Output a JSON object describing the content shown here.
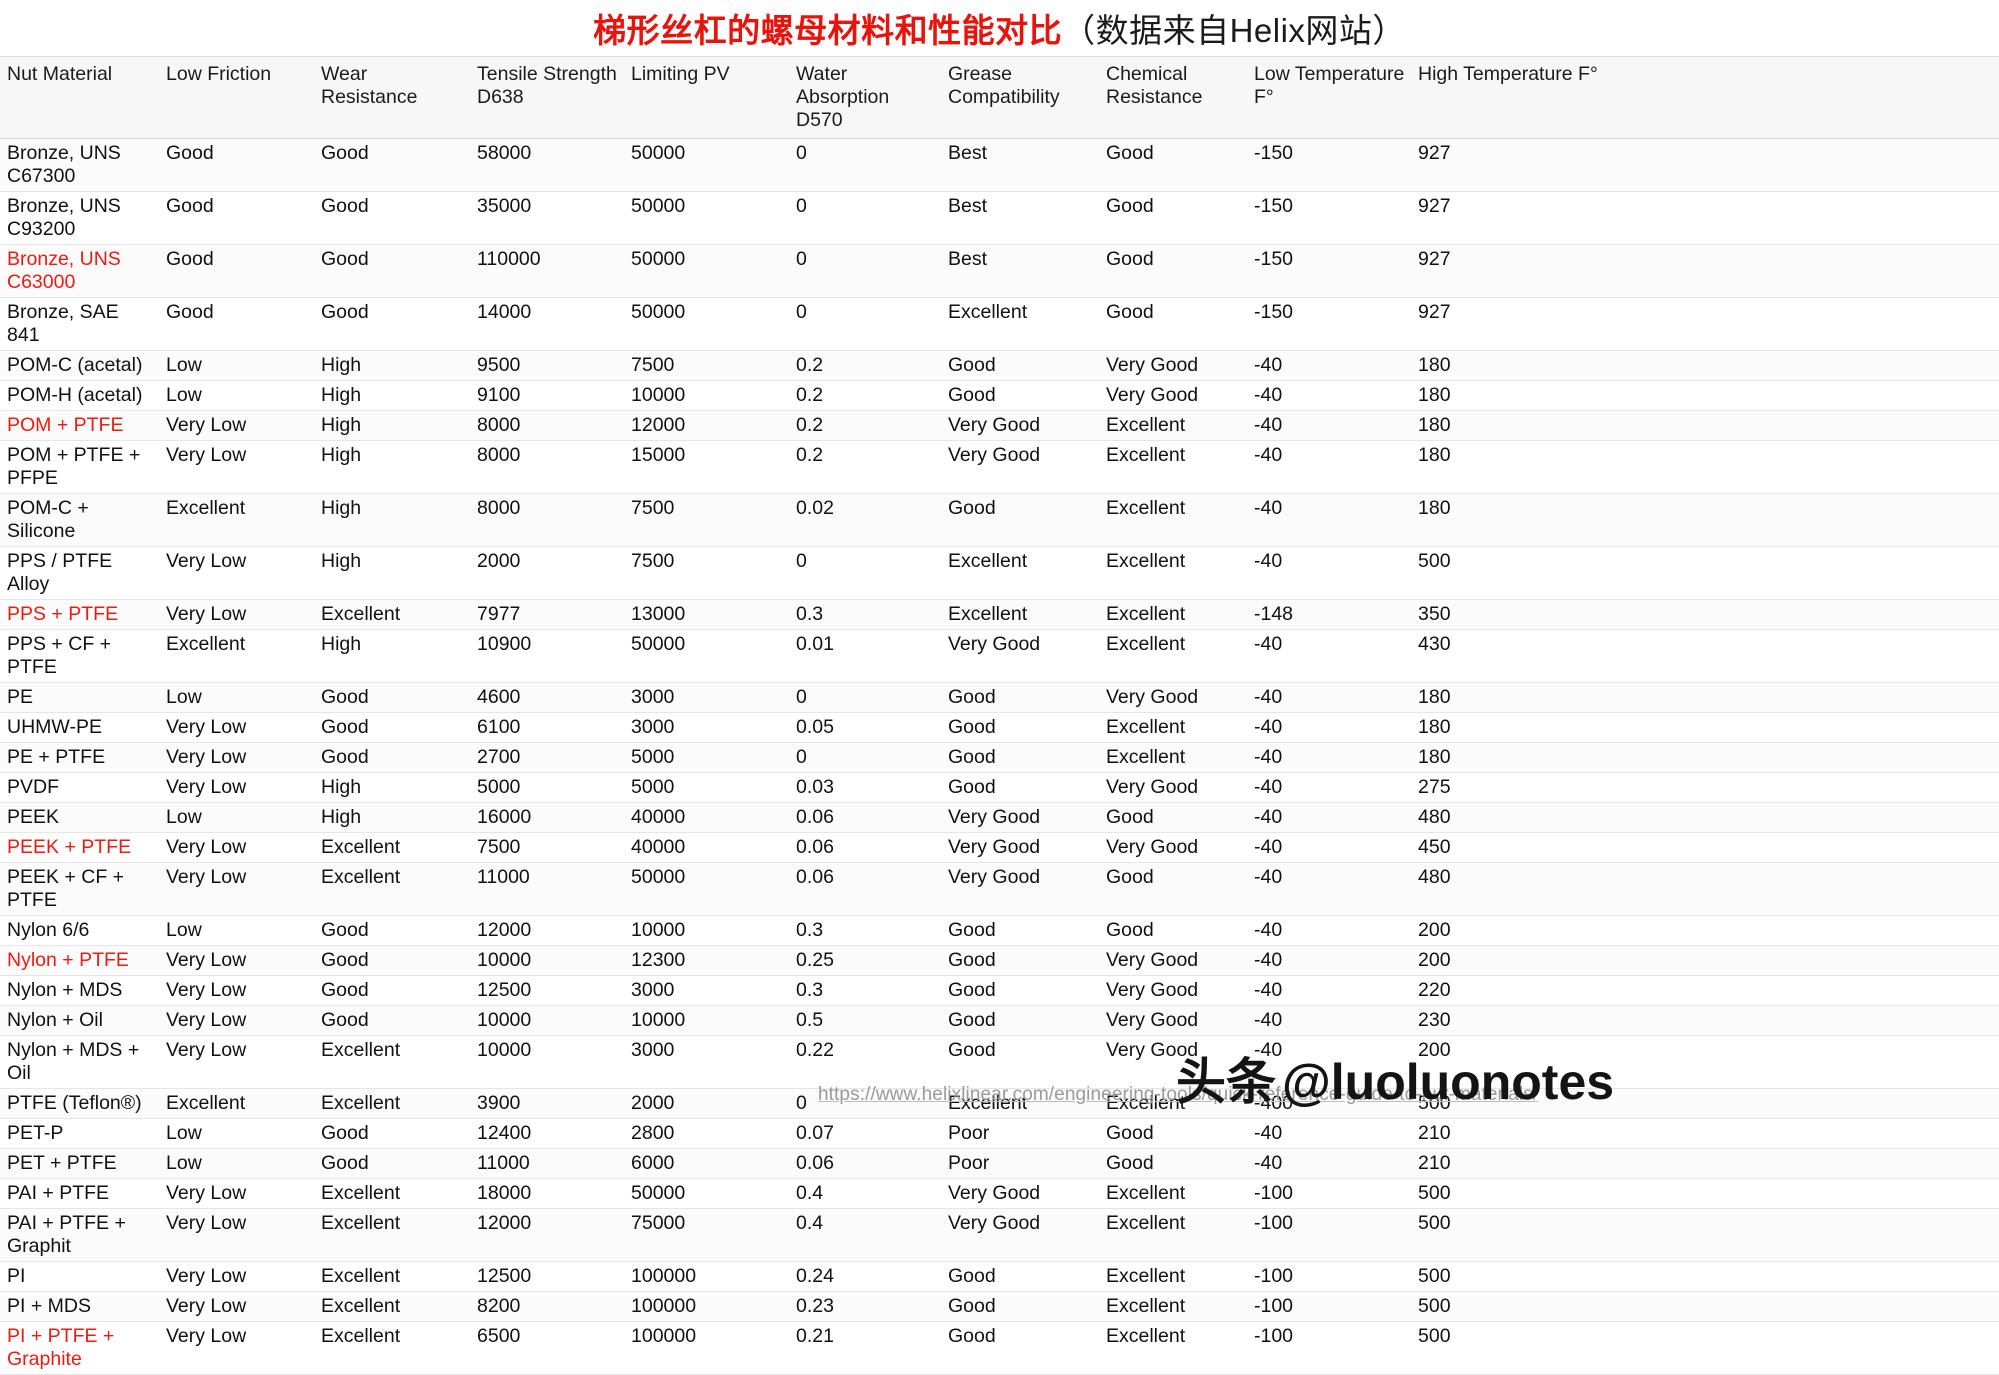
{
  "title": {
    "red_part": "梯形丝杠的螺母材料和性能对比",
    "black_part": "（数据来自Helix网站）"
  },
  "table": {
    "columns": [
      "Nut Material",
      "Low Friction",
      "Wear Resistance",
      "Tensile Strength D638",
      "Limiting PV",
      "Water Absorption D570",
      "Grease Compatibility",
      "Chemical Resistance",
      "Low Temperature F°",
      "High Temperature F°"
    ],
    "rows": [
      {
        "material": "Bronze, UNS C67300",
        "highlight": false,
        "low_friction": "Good",
        "wear_resistance": "Good",
        "tensile_strength": "58000",
        "limiting_pv": "50000",
        "water_absorption": "0",
        "grease_compatibility": "Best",
        "chemical_resistance": "Good",
        "low_temp": "-150",
        "high_temp": "927"
      },
      {
        "material": "Bronze, UNS C93200",
        "highlight": false,
        "low_friction": "Good",
        "wear_resistance": "Good",
        "tensile_strength": "35000",
        "limiting_pv": "50000",
        "water_absorption": "0",
        "grease_compatibility": "Best",
        "chemical_resistance": "Good",
        "low_temp": "-150",
        "high_temp": "927"
      },
      {
        "material": "Bronze, UNS C63000",
        "highlight": true,
        "low_friction": "Good",
        "wear_resistance": "Good",
        "tensile_strength": "110000",
        "limiting_pv": "50000",
        "water_absorption": "0",
        "grease_compatibility": "Best",
        "chemical_resistance": "Good",
        "low_temp": "-150",
        "high_temp": "927"
      },
      {
        "material": "Bronze, SAE 841",
        "highlight": false,
        "low_friction": "Good",
        "wear_resistance": "Good",
        "tensile_strength": "14000",
        "limiting_pv": "50000",
        "water_absorption": "0",
        "grease_compatibility": "Excellent",
        "chemical_resistance": "Good",
        "low_temp": "-150",
        "high_temp": "927"
      },
      {
        "material": "POM-C (acetal)",
        "highlight": false,
        "low_friction": "Low",
        "wear_resistance": "High",
        "tensile_strength": "9500",
        "limiting_pv": "7500",
        "water_absorption": "0.2",
        "grease_compatibility": "Good",
        "chemical_resistance": "Very Good",
        "low_temp": "-40",
        "high_temp": "180"
      },
      {
        "material": "POM-H (acetal)",
        "highlight": false,
        "low_friction": "Low",
        "wear_resistance": "High",
        "tensile_strength": "9100",
        "limiting_pv": "10000",
        "water_absorption": "0.2",
        "grease_compatibility": "Good",
        "chemical_resistance": "Very Good",
        "low_temp": "-40",
        "high_temp": "180"
      },
      {
        "material": "POM + PTFE",
        "highlight": true,
        "low_friction": "Very Low",
        "wear_resistance": "High",
        "tensile_strength": "8000",
        "limiting_pv": "12000",
        "water_absorption": "0.2",
        "grease_compatibility": "Very Good",
        "chemical_resistance": "Excellent",
        "low_temp": "-40",
        "high_temp": "180"
      },
      {
        "material": "POM + PTFE + PFPE",
        "highlight": false,
        "low_friction": "Very Low",
        "wear_resistance": "High",
        "tensile_strength": "8000",
        "limiting_pv": "15000",
        "water_absorption": "0.2",
        "grease_compatibility": "Very Good",
        "chemical_resistance": "Excellent",
        "low_temp": "-40",
        "high_temp": "180"
      },
      {
        "material": "POM-C + Silicone",
        "highlight": false,
        "low_friction": "Excellent",
        "wear_resistance": "High",
        "tensile_strength": "8000",
        "limiting_pv": "7500",
        "water_absorption": "0.02",
        "grease_compatibility": "Good",
        "chemical_resistance": "Excellent",
        "low_temp": "-40",
        "high_temp": "180"
      },
      {
        "material": "PPS / PTFE Alloy",
        "highlight": false,
        "low_friction": "Very Low",
        "wear_resistance": "High",
        "tensile_strength": "2000",
        "limiting_pv": "7500",
        "water_absorption": "0",
        "grease_compatibility": "Excellent",
        "chemical_resistance": "Excellent",
        "low_temp": "-40",
        "high_temp": "500"
      },
      {
        "material": "PPS + PTFE",
        "highlight": true,
        "low_friction": "Very Low",
        "wear_resistance": "Excellent",
        "tensile_strength": "7977",
        "limiting_pv": "13000",
        "water_absorption": "0.3",
        "grease_compatibility": "Excellent",
        "chemical_resistance": "Excellent",
        "low_temp": "-148",
        "high_temp": "350"
      },
      {
        "material": "PPS + CF + PTFE",
        "highlight": false,
        "low_friction": "Excellent",
        "wear_resistance": "High",
        "tensile_strength": "10900",
        "limiting_pv": "50000",
        "water_absorption": "0.01",
        "grease_compatibility": "Very Good",
        "chemical_resistance": "Excellent",
        "low_temp": "-40",
        "high_temp": "430"
      },
      {
        "material": "PE",
        "highlight": false,
        "low_friction": "Low",
        "wear_resistance": "Good",
        "tensile_strength": "4600",
        "limiting_pv": "3000",
        "water_absorption": "0",
        "grease_compatibility": "Good",
        "chemical_resistance": "Very Good",
        "low_temp": "-40",
        "high_temp": "180"
      },
      {
        "material": "UHMW-PE",
        "highlight": false,
        "low_friction": "Very Low",
        "wear_resistance": "Good",
        "tensile_strength": "6100",
        "limiting_pv": "3000",
        "water_absorption": "0.05",
        "grease_compatibility": "Good",
        "chemical_resistance": "Excellent",
        "low_temp": "-40",
        "high_temp": "180"
      },
      {
        "material": "PE + PTFE",
        "highlight": false,
        "low_friction": "Very Low",
        "wear_resistance": "Good",
        "tensile_strength": "2700",
        "limiting_pv": "5000",
        "water_absorption": "0",
        "grease_compatibility": "Good",
        "chemical_resistance": "Excellent",
        "low_temp": "-40",
        "high_temp": "180"
      },
      {
        "material": "PVDF",
        "highlight": false,
        "low_friction": "Very Low",
        "wear_resistance": "High",
        "tensile_strength": "5000",
        "limiting_pv": "5000",
        "water_absorption": "0.03",
        "grease_compatibility": "Good",
        "chemical_resistance": "Very Good",
        "low_temp": "-40",
        "high_temp": "275"
      },
      {
        "material": "PEEK",
        "highlight": false,
        "low_friction": "Low",
        "wear_resistance": "High",
        "tensile_strength": "16000",
        "limiting_pv": "40000",
        "water_absorption": "0.06",
        "grease_compatibility": "Very Good",
        "chemical_resistance": "Good",
        "low_temp": "-40",
        "high_temp": "480"
      },
      {
        "material": "PEEK + PTFE",
        "highlight": true,
        "low_friction": "Very Low",
        "wear_resistance": "Excellent",
        "tensile_strength": "7500",
        "limiting_pv": "40000",
        "water_absorption": "0.06",
        "grease_compatibility": "Very Good",
        "chemical_resistance": "Very Good",
        "low_temp": "-40",
        "high_temp": "450"
      },
      {
        "material": "PEEK + CF + PTFE",
        "highlight": false,
        "low_friction": "Very Low",
        "wear_resistance": "Excellent",
        "tensile_strength": "11000",
        "limiting_pv": "50000",
        "water_absorption": "0.06",
        "grease_compatibility": "Very Good",
        "chemical_resistance": "Good",
        "low_temp": "-40",
        "high_temp": "480"
      },
      {
        "material": "Nylon 6/6",
        "highlight": false,
        "low_friction": "Low",
        "wear_resistance": "Good",
        "tensile_strength": "12000",
        "limiting_pv": "10000",
        "water_absorption": "0.3",
        "grease_compatibility": "Good",
        "chemical_resistance": "Good",
        "low_temp": "-40",
        "high_temp": "200"
      },
      {
        "material": "Nylon + PTFE",
        "highlight": true,
        "low_friction": "Very Low",
        "wear_resistance": "Good",
        "tensile_strength": "10000",
        "limiting_pv": "12300",
        "water_absorption": "0.25",
        "grease_compatibility": "Good",
        "chemical_resistance": "Very Good",
        "low_temp": "-40",
        "high_temp": "200"
      },
      {
        "material": "Nylon + MDS",
        "highlight": false,
        "low_friction": "Very Low",
        "wear_resistance": "Good",
        "tensile_strength": "12500",
        "limiting_pv": "3000",
        "water_absorption": "0.3",
        "grease_compatibility": "Good",
        "chemical_resistance": "Very Good",
        "low_temp": "-40",
        "high_temp": "220"
      },
      {
        "material": "Nylon + Oil",
        "highlight": false,
        "low_friction": "Very Low",
        "wear_resistance": "Good",
        "tensile_strength": "10000",
        "limiting_pv": "10000",
        "water_absorption": "0.5",
        "grease_compatibility": "Good",
        "chemical_resistance": "Very Good",
        "low_temp": "-40",
        "high_temp": "230"
      },
      {
        "material": "Nylon + MDS + Oil",
        "highlight": false,
        "low_friction": "Very Low",
        "wear_resistance": "Excellent",
        "tensile_strength": "10000",
        "limiting_pv": "3000",
        "water_absorption": "0.22",
        "grease_compatibility": "Good",
        "chemical_resistance": "Very Good",
        "low_temp": "-40",
        "high_temp": "200"
      },
      {
        "material": "PTFE (Teflon®)",
        "highlight": false,
        "low_friction": "Excellent",
        "wear_resistance": "Excellent",
        "tensile_strength": "3900",
        "limiting_pv": "2000",
        "water_absorption": "0",
        "grease_compatibility": "Excellent",
        "chemical_resistance": "Excellent",
        "low_temp": "-400",
        "high_temp": "500"
      },
      {
        "material": "PET-P",
        "highlight": false,
        "low_friction": "Low",
        "wear_resistance": "Good",
        "tensile_strength": "12400",
        "limiting_pv": "2800",
        "water_absorption": "0.07",
        "grease_compatibility": "Poor",
        "chemical_resistance": "Good",
        "low_temp": "-40",
        "high_temp": "210"
      },
      {
        "material": "PET + PTFE",
        "highlight": false,
        "low_friction": "Low",
        "wear_resistance": "Good",
        "tensile_strength": "11000",
        "limiting_pv": "6000",
        "water_absorption": "0.06",
        "grease_compatibility": "Poor",
        "chemical_resistance": "Good",
        "low_temp": "-40",
        "high_temp": "210"
      },
      {
        "material": "PAI + PTFE",
        "highlight": false,
        "low_friction": "Very Low",
        "wear_resistance": "Excellent",
        "tensile_strength": "18000",
        "limiting_pv": "50000",
        "water_absorption": "0.4",
        "grease_compatibility": "Very Good",
        "chemical_resistance": "Excellent",
        "low_temp": "-100",
        "high_temp": "500"
      },
      {
        "material": "PAI + PTFE + Graphit",
        "highlight": false,
        "low_friction": "Very Low",
        "wear_resistance": "Excellent",
        "tensile_strength": "12000",
        "limiting_pv": "75000",
        "water_absorption": "0.4",
        "grease_compatibility": "Very Good",
        "chemical_resistance": "Excellent",
        "low_temp": "-100",
        "high_temp": "500"
      },
      {
        "material": "PI",
        "highlight": false,
        "low_friction": "Very Low",
        "wear_resistance": "Excellent",
        "tensile_strength": "12500",
        "limiting_pv": "100000",
        "water_absorption": "0.24",
        "grease_compatibility": "Good",
        "chemical_resistance": "Excellent",
        "low_temp": "-100",
        "high_temp": "500"
      },
      {
        "material": "PI + MDS",
        "highlight": false,
        "low_friction": "Very Low",
        "wear_resistance": "Excellent",
        "tensile_strength": "8200",
        "limiting_pv": "100000",
        "water_absorption": "0.23",
        "grease_compatibility": "Good",
        "chemical_resistance": "Excellent",
        "low_temp": "-100",
        "high_temp": "500"
      },
      {
        "material": "PI + PTFE + Graphite",
        "highlight": true,
        "low_friction": "Very Low",
        "wear_resistance": "Excellent",
        "tensile_strength": "6500",
        "limiting_pv": "100000",
        "water_absorption": "0.21",
        "grease_compatibility": "Good",
        "chemical_resistance": "Excellent",
        "low_temp": "-100",
        "high_temp": "500"
      }
    ]
  },
  "footer": {
    "source_url": "https://www.helixlinear.com/engineering-tools/quick-reference-guide-to-nut-materials/",
    "watermark_cn": "头条",
    "watermark_handle": "@luoluonotes"
  },
  "colors": {
    "highlight_red": "#ec1c12",
    "title_red": "#e8140c",
    "header_bg": "#f7f7f7"
  }
}
